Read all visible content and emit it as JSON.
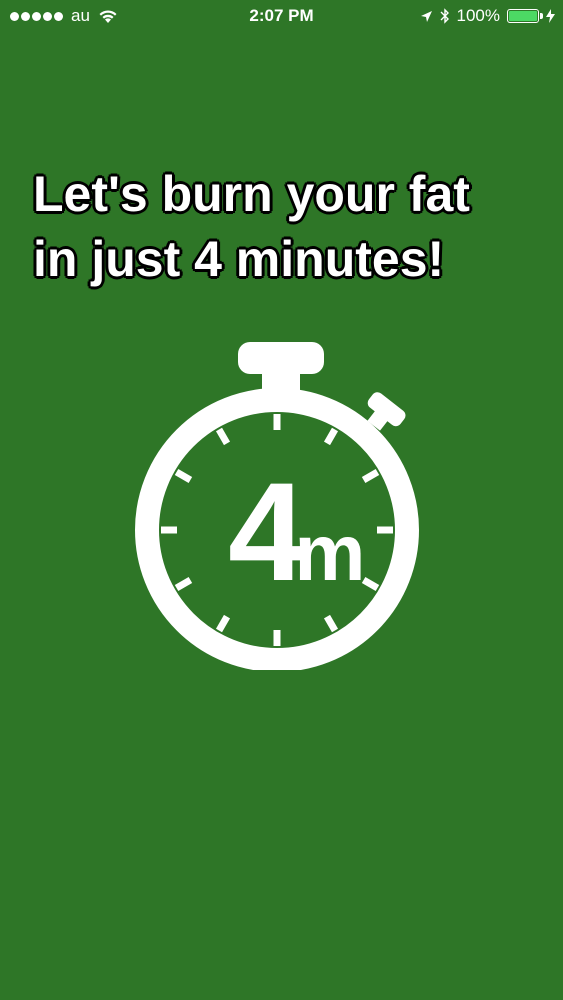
{
  "status_bar": {
    "carrier": "au",
    "time": "2:07 PM",
    "battery_percent": "100%",
    "signal_icon": "signal-dots-icon",
    "wifi_icon": "wifi-icon",
    "location_icon": "location-arrow-icon",
    "bluetooth_icon": "bluetooth-icon",
    "battery_icon": "battery-icon",
    "charging_icon": "charging-bolt-icon"
  },
  "main": {
    "headline_line1": "Let's burn your fat",
    "headline_line2": "in just 4 minutes!",
    "stopwatch_number": "4",
    "stopwatch_unit": "m",
    "stopwatch_icon": "stopwatch-icon"
  },
  "colors": {
    "background": "#2e7627",
    "foreground": "#ffffff",
    "battery_fill": "#4cd964"
  }
}
